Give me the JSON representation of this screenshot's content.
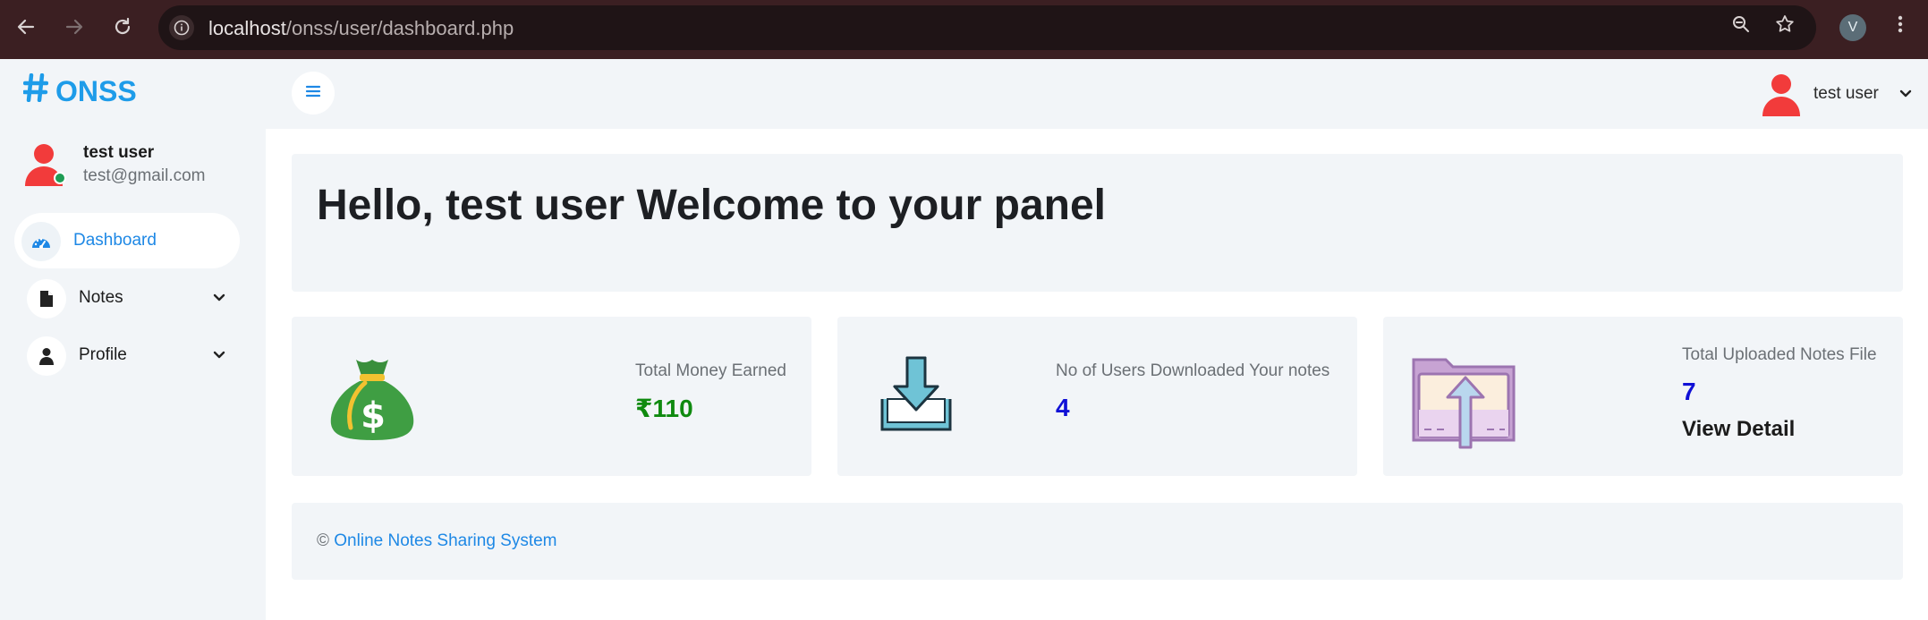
{
  "browser": {
    "url_host": "localhost",
    "url_path": "/onss/user/dashboard.php",
    "profile_initial": "V"
  },
  "sidebar": {
    "brand": "ONSS",
    "user": {
      "name": "test user",
      "email": "test@gmail.com"
    },
    "items": [
      {
        "label": "Dashboard",
        "icon": "dashboard-gauge-icon",
        "active": true
      },
      {
        "label": "Notes",
        "icon": "file-icon",
        "active": false
      },
      {
        "label": "Profile",
        "icon": "user-icon",
        "active": false
      }
    ]
  },
  "topbar": {
    "user_name": "test user"
  },
  "welcome": {
    "heading": "Hello, test user Welcome to your panel"
  },
  "stats": [
    {
      "label": "Total Money Earned",
      "value": "₹110",
      "color": "#0f8a0f",
      "icon": "money-bag-icon"
    },
    {
      "label": "No of Users Downloaded Your notes",
      "value": "4",
      "color": "#1010d6",
      "icon": "download-icon"
    },
    {
      "label": "Total Uploaded Notes File",
      "value": "7",
      "color": "#1010d6",
      "link": "View Detail",
      "icon": "folder-upload-icon"
    }
  ],
  "footer": {
    "symbol": "©",
    "link_text": "Online Notes Sharing System"
  },
  "colors": {
    "accent": "#1e88e5",
    "brand": "#1e9ce9",
    "avatar": "#f23b3b"
  }
}
